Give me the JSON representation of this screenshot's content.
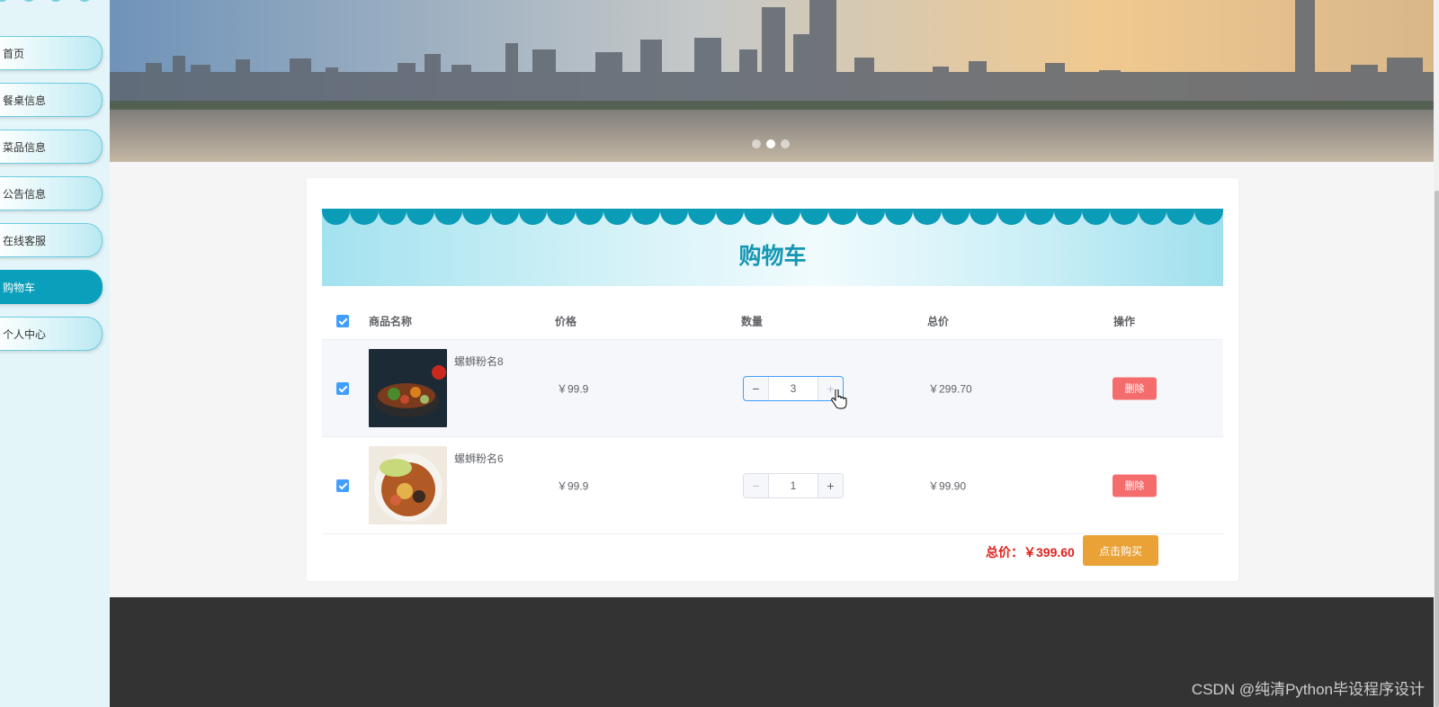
{
  "sidebar": {
    "items": [
      {
        "label": "首页",
        "active": false
      },
      {
        "label": "餐桌信息",
        "active": false
      },
      {
        "label": "菜品信息",
        "active": false
      },
      {
        "label": "公告信息",
        "active": false
      },
      {
        "label": "在线客服",
        "active": false
      },
      {
        "label": "购物车",
        "active": true
      },
      {
        "label": "个人中心",
        "active": false
      }
    ]
  },
  "banner": {
    "active_slide_index": 1,
    "slide_count": 3
  },
  "cart": {
    "title": "购物车",
    "columns": {
      "name": "商品名称",
      "price": "价格",
      "quantity": "数量",
      "total": "总价",
      "action": "操作"
    },
    "rows": [
      {
        "name": "螺蛳粉名8",
        "price": "￥99.9",
        "quantity": "3",
        "total": "￥299.70",
        "delete_label": "删除",
        "checked": true,
        "image_icon": "noodle-bowl-dark"
      },
      {
        "name": "螺蛳粉名6",
        "price": "￥99.9",
        "quantity": "1",
        "total": "￥99.90",
        "delete_label": "删除",
        "checked": true,
        "image_icon": "noodle-bowl-light"
      }
    ],
    "grand_total_label": "总价：",
    "grand_total_value": "￥399.60",
    "buy_label": "点击购买"
  },
  "watermark": "CSDN @纯清Python毕设程序设计",
  "colors": {
    "accent": "#0a9fba",
    "delete": "#f56c6c",
    "buy": "#eaa237",
    "total_red": "#e0211b",
    "checkbox": "#409eff",
    "footer": "#333333"
  }
}
